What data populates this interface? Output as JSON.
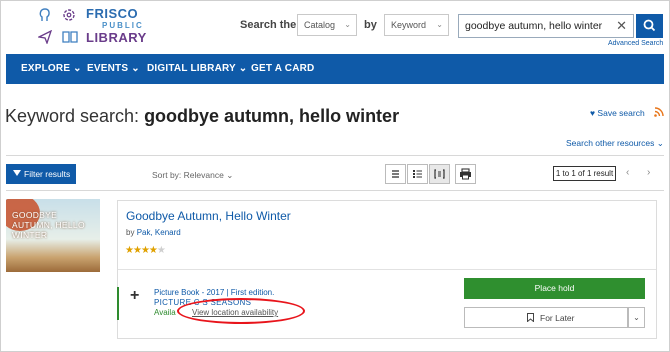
{
  "logo": {
    "line1": "FRISCO",
    "line2": "PUBLIC",
    "line3": "LIBRARY",
    "icons": [
      "head-icon",
      "gear-flower-icon",
      "paper-plane-icon",
      "book-icon"
    ]
  },
  "search": {
    "label": "Search the",
    "scope": "Catalog",
    "by_label": "by",
    "field": "Keyword",
    "query": "goodbye autumn, hello winter",
    "advanced": "Advanced Search"
  },
  "nav": {
    "items": [
      "EXPLORE",
      "EVENTS",
      "DIGITAL LIBRARY",
      "GET A CARD"
    ]
  },
  "results": {
    "heading_prefix": "Keyword search: ",
    "heading_query": "goodbye autumn, hello winter",
    "save_search": "Save search",
    "other_resources": "Search other resources",
    "filter": "Filter results",
    "sort": "Sort by: Relevance",
    "count": "1 to 1 of 1 result"
  },
  "item": {
    "cover_text": "GOODBYE AUTUMN, HELLO WINTER",
    "title": "Goodbye Autumn, Hello Winter",
    "by": "by",
    "author": "Pak, Kenard",
    "rating": 4,
    "stars": "★★★★★",
    "format": "Picture Book - 2017 | First edition.",
    "series": "PICTURE C     S SEASONS",
    "availability": "Availa",
    "view_location": "View location availability",
    "place_hold": "Place hold",
    "for_later": "For Later"
  },
  "colors": {
    "brand_blue": "#0f5aa8",
    "hold_green": "#2f8f2f",
    "star_gold": "#e0a100",
    "annotation_red": "#e8141b"
  }
}
